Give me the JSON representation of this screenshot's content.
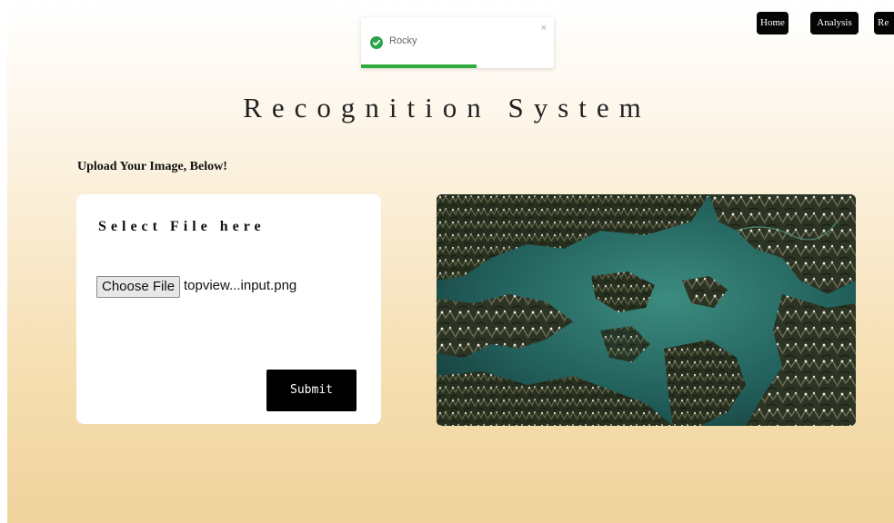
{
  "nav": {
    "home_label": "Home",
    "analysis_label": "Analysis",
    "third_label": "Re"
  },
  "toast": {
    "message": "Rocky",
    "close_symbol": "×",
    "progress": 0.6,
    "icon": "check-circle-icon",
    "accent_color": "#2fac3c"
  },
  "page": {
    "title": "Recognition System",
    "upload_label": "Upload Your Image, Below!"
  },
  "form": {
    "card_title": "Select File here",
    "choose_file_label": "Choose File",
    "file_name": "topview...input.png",
    "submit_label": "Submit"
  },
  "preview": {
    "description_icon": "satellite-image"
  }
}
